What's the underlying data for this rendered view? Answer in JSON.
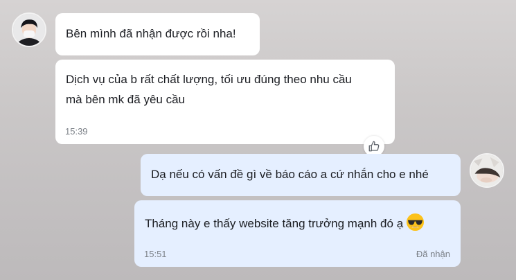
{
  "conversation": {
    "messages": [
      {
        "sender": "contact",
        "text": "Bên mình đã nhận được rồi nha!"
      },
      {
        "sender": "contact",
        "text_lines": [
          "Dịch vụ của b rất chất lượng, tối ưu đúng theo nhu cầu",
          "mà bên mk đã yêu cầu"
        ],
        "time": "15:39",
        "reaction_icon": "thumbs-up-icon"
      },
      {
        "sender": "self",
        "text": "Dạ nếu có vấn đề gì về báo cáo a cứ nhắn cho e nhé"
      },
      {
        "sender": "self",
        "text": "Tháng này e thấy website tăng trưởng mạnh đó ạ",
        "emoji": "sunglasses-emoji",
        "time": "15:51",
        "status": "Đã nhận"
      }
    ]
  },
  "colors": {
    "incoming_bubble": "#ffffff",
    "outgoing_bubble": "#e5efff",
    "background": "#c8c5c5",
    "meta_text": "#7a7f86"
  }
}
